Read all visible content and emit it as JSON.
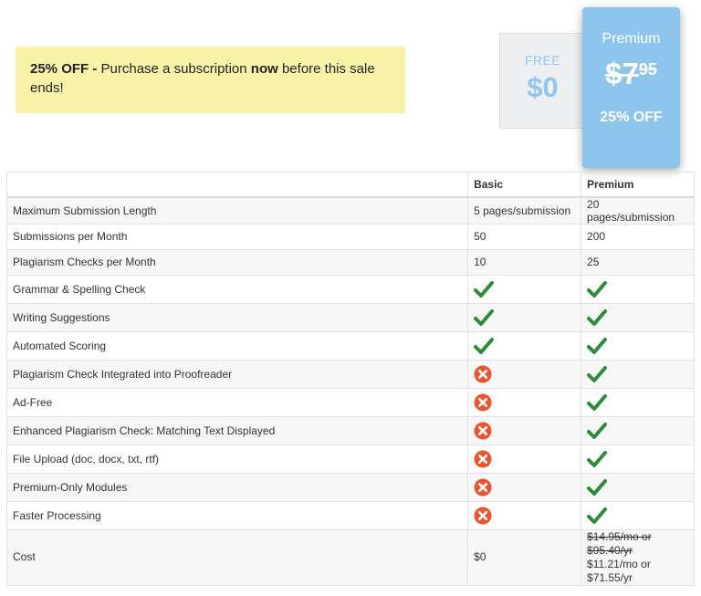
{
  "banner": {
    "discount": "25% OFF",
    "dash": " - ",
    "text_before": "Purchase a subscription ",
    "text_bold": "now",
    "text_after": " before this sale ends!"
  },
  "free_card": {
    "label": "FREE",
    "price": "$0"
  },
  "premium_card": {
    "label": "Premium",
    "old_price": "$7",
    "old_cents": "95",
    "discount": "25% OFF"
  },
  "table": {
    "headers": [
      "",
      "Basic",
      "Premium"
    ],
    "rows": [
      {
        "feature": "Maximum Submission Length",
        "basic": "5 pages/submission",
        "premium": "20 pages/submission"
      },
      {
        "feature": "Submissions per Month",
        "basic": "50",
        "premium": "200"
      },
      {
        "feature": "Plagiarism Checks per Month",
        "basic": "10",
        "premium": "25"
      },
      {
        "feature": "Grammar & Spelling Check",
        "basic": "check",
        "premium": "check"
      },
      {
        "feature": "Writing Suggestions",
        "basic": "check",
        "premium": "check"
      },
      {
        "feature": "Automated Scoring",
        "basic": "check",
        "premium": "check"
      },
      {
        "feature": "Plagiarism Check Integrated into Proofreader",
        "basic": "cross",
        "premium": "check"
      },
      {
        "feature": "Ad-Free",
        "basic": "cross",
        "premium": "check"
      },
      {
        "feature": "Enhanced Plagiarism Check: Matching Text Displayed",
        "basic": "cross",
        "premium": "check"
      },
      {
        "feature": "File Upload (doc, docx, txt, rtf)",
        "basic": "cross",
        "premium": "check"
      },
      {
        "feature": "Premium-Only Modules",
        "basic": "cross",
        "premium": "check"
      },
      {
        "feature": "Faster Processing",
        "basic": "cross",
        "premium": "check"
      }
    ],
    "cost": {
      "feature": "Cost",
      "basic": "$0",
      "premium_old_1": "$14.95/mo or",
      "premium_old_2": "$95.40/yr",
      "premium_new_1": "$11.21/mo or",
      "premium_new_2": "$71.55/yr"
    }
  },
  "icons": {
    "check": "green-checkmark-icon",
    "cross": "red-x-circle-icon"
  },
  "colors": {
    "banner_bg": "#f9f3a9",
    "premium_bg": "#8ec5ec",
    "free_text": "#8fc7ee",
    "check": "#2e8b3a",
    "cross": "#e8552f"
  }
}
